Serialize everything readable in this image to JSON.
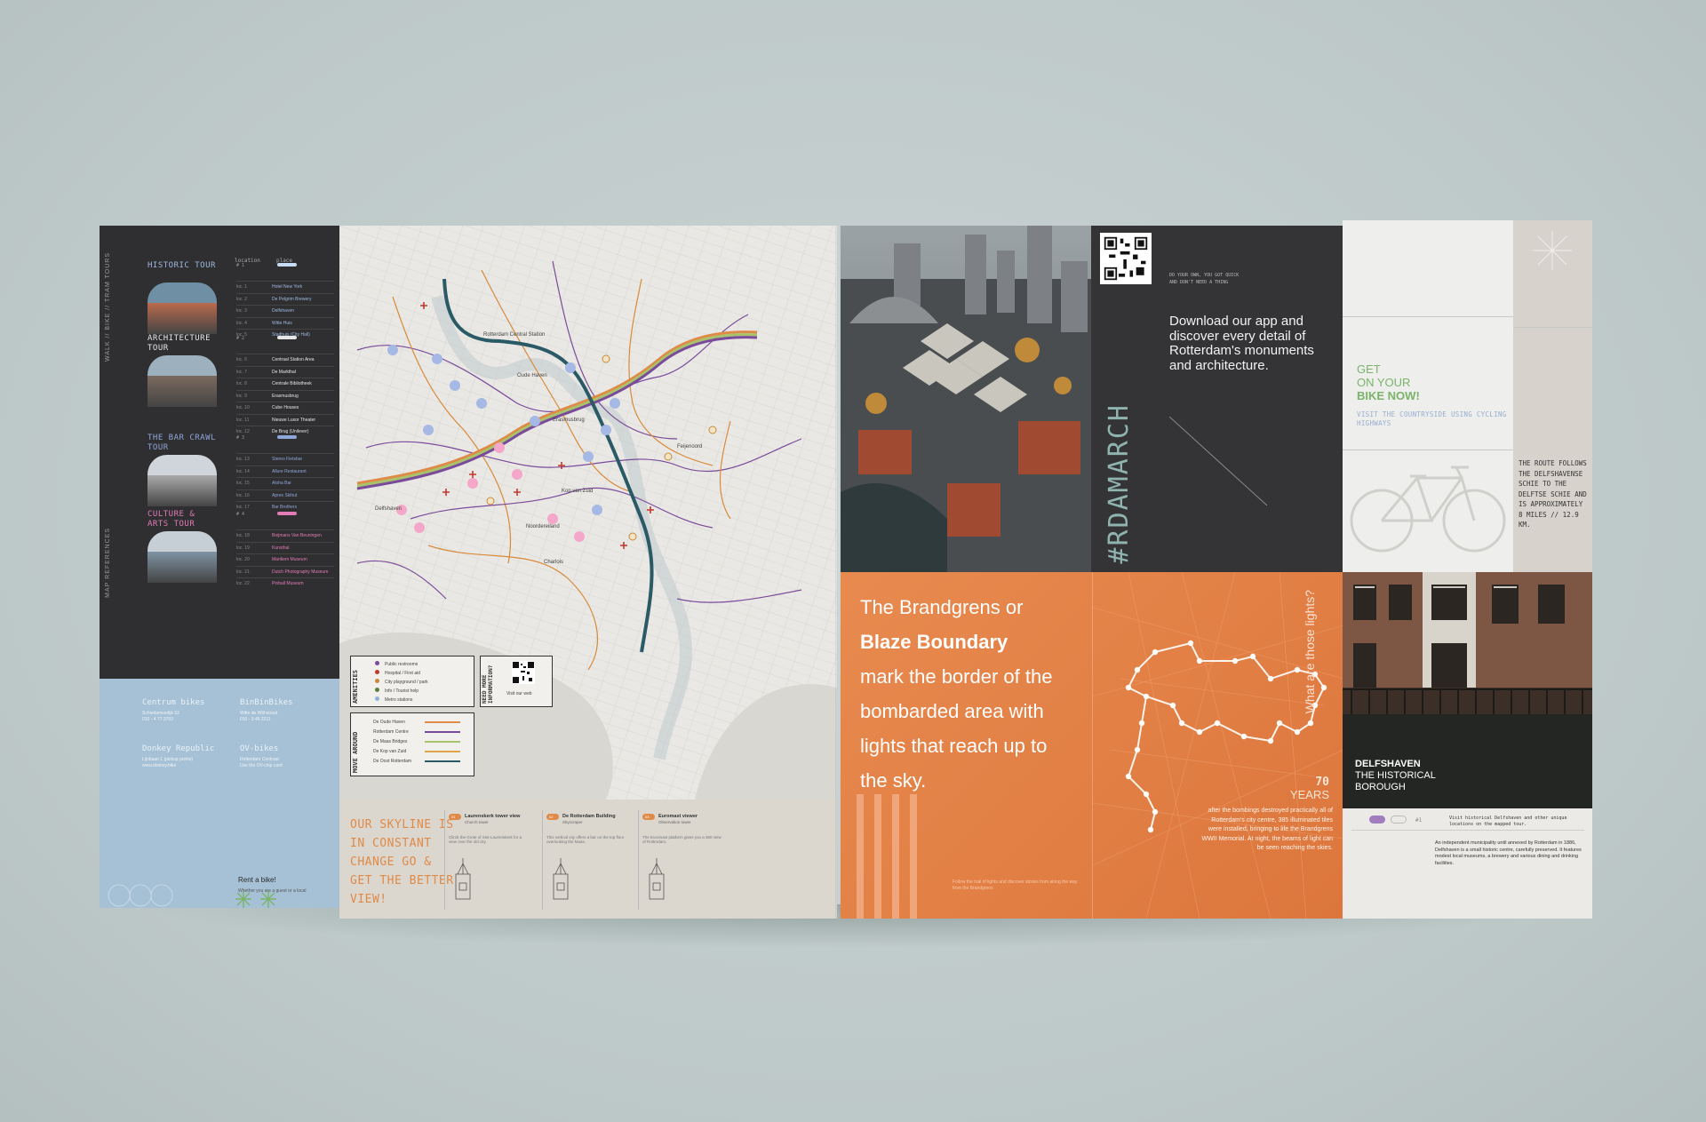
{
  "panel_tours": {
    "vertical_text": "WALK // BIKE // TRAM TOURS",
    "vertical_text_2": "MAP REFERENCES",
    "col_location": "location",
    "col_place": "place",
    "tours": [
      {
        "title": "HISTORIC TOUR",
        "color": "#9fb8e0",
        "pill": "#c8dcf5",
        "num": "# 1",
        "rows": [
          [
            "loc. 1",
            "Hotel New York"
          ],
          [
            "loc. 2",
            "De Pelgrim Brewery"
          ],
          [
            "loc. 3",
            "Delfshaven"
          ],
          [
            "loc. 4",
            "Witte Huis"
          ],
          [
            "loc. 5",
            "Stadhuis (City Hall)"
          ]
        ]
      },
      {
        "title": "ARCHITECTURE TOUR",
        "color": "#e6e6e6",
        "pill": "#e6e6e6",
        "num": "# 2",
        "rows": [
          [
            "loc. 6",
            "Centraal Station Area"
          ],
          [
            "loc. 7",
            "De Markthal"
          ],
          [
            "loc. 8",
            "Centrale Bibliotheek"
          ],
          [
            "loc. 9",
            "Erasmusbrug"
          ],
          [
            "loc. 10",
            "Cube Houses"
          ],
          [
            "loc. 11",
            "Nieuwe Luxor Theater"
          ],
          [
            "loc. 12",
            "De Brug (Unilever)"
          ]
        ]
      },
      {
        "title": "THE BAR CRAWL TOUR",
        "color": "#8fa6d8",
        "pill": "#8fa6d8",
        "num": "# 3",
        "rows": [
          [
            "loc. 13",
            "Stereo Fietsbar"
          ],
          [
            "loc. 14",
            "Allure Restaurant"
          ],
          [
            "loc. 15",
            "Aloha Bar"
          ],
          [
            "loc. 16",
            "Apres Skihut"
          ],
          [
            "loc. 17",
            "Bar Brothers"
          ]
        ]
      },
      {
        "title": "CULTURE & ARTS TOUR",
        "color": "#e37bb7",
        "pill": "#e37bb7",
        "num": "# 4",
        "rows": [
          [
            "loc. 18",
            "Boijmans Van Beuningen"
          ],
          [
            "loc. 19",
            "Kunsthal"
          ],
          [
            "loc. 20",
            "Maritiem Museum"
          ],
          [
            "loc. 21",
            "Dutch Photography Museum"
          ],
          [
            "loc. 22",
            "Pinball Museum"
          ]
        ]
      }
    ],
    "bikes": [
      {
        "name": "Centrum bikes",
        "info": "Schiedamsedijk 52\n010 - 4 77 3702"
      },
      {
        "name": "BinBinBikes",
        "info": "Witte de Withstraat\n010 - 3 45 2211"
      },
      {
        "name": "Donkey Republic",
        "info": "Lijnbaan 1 (pickup points)\nwww.donkey.bike"
      },
      {
        "name": "OV-bikes",
        "info": "Rotterdam Centraal\nUse the OV-chip card"
      }
    ],
    "rent_title": "Rent a bike!",
    "rent_sub": "Whether you are a guest or a local"
  },
  "panel_map": {
    "labels": [
      "Rotterdam Central Station",
      "Oude Haven",
      "Erasmusbrug",
      "Kop van Zuid",
      "Feijenoord",
      "Delfshaven",
      "Noordereiland",
      "Charlois"
    ],
    "legend_amenities_title": "AMENITIES",
    "legend_amenities": [
      "Public restrooms",
      "Hospital / First aid",
      "City playground / park",
      "Info / Tourist help",
      "Metro stations"
    ],
    "legend_need_title": "NEED MORE INFORMATION?",
    "legend_visit": "Visit our web",
    "legend_move_title": "MOVE AROUND",
    "legend_move": [
      "De Oude Haven",
      "Rotterdam Centre",
      "De Maas Bridges",
      "De Kop van Zuid",
      "De Oost Rotterdam"
    ],
    "skyline_text": "OUR SKYLINE IS IN CONSTANT CHANGE GO & GET THE BETTER VIEW!",
    "cards": [
      {
        "title": "Laurenskerk tower view",
        "sub": "Church tower",
        "num": "01",
        "desc": "Climb the Grote of Sint-Laurenskerk for a view over the old city."
      },
      {
        "title": "De Rotterdam Building",
        "sub": "Skyscraper",
        "num": "02",
        "desc": "This vertical city offers a bar on the top floor overlooking the Maas."
      },
      {
        "title": "Euromast viewer",
        "sub": "Observation tower",
        "num": "03",
        "desc": "The Euromast platform gives you a 360 view of Rotterdam."
      }
    ]
  },
  "panel_app": {
    "small1": "DO YOUR OWN, YOU GOT QUICK",
    "small2": "AND DON'T NEED A THING",
    "headline": "Download our app and discover every detail of Rotterdam's monuments and architecture.",
    "hashtag": "#RDAMARCH"
  },
  "panel_bike": {
    "get1": "GET",
    "get2": "ON YOUR",
    "get3": "BIKE NOW!",
    "visit": "VISIT THE COUNTRYSIDE USING CYCLING HIGHWAYS",
    "route": "THE ROUTE FOLLOWS THE DELFSHAVENSE SCHIE TO THE DELFTSE SCHIE AND IS APPROXIMATELY 8 MILES // 12.9 KM."
  },
  "panel_orange": {
    "line1": "The Brandgrens or",
    "line2": "Blaze Boundary",
    "line3": "mark the border of the bombarded area with lights that reach up to the sky.",
    "question": "What are those lights?",
    "years_num": "70",
    "years": "YEARS",
    "para": "after the bombings destroyed practically all of Rotterdam's city centre, 385 illuminated tiles were installed, bringing to life the Brandgrens WWII Memorial. At night, the beams of light can be seen reaching the skies.",
    "footer": "Follow the trail of lights and discover stories from along the way from the Brandgrens"
  },
  "panel_delfshaven": {
    "title": "DELFSHAVEN",
    "sub1": "THE HISTORICAL",
    "sub2": "BOROUGH",
    "num": "#1",
    "visit": "Visit historical Delfshaven and other unique locations on the mapped tour.",
    "indep": "An independent municipality until annexed by Rotterdam in 1886, Delfshaven is a small historic centre, carefully preserved. It features modest local museums, a brewery and various dining and drinking facilities."
  },
  "colors": {
    "orange": "#e27f45",
    "dark": "#2f2f31",
    "blue": "#a6c1d6",
    "green": "#7bb36b",
    "pink": "#e37bb7"
  }
}
